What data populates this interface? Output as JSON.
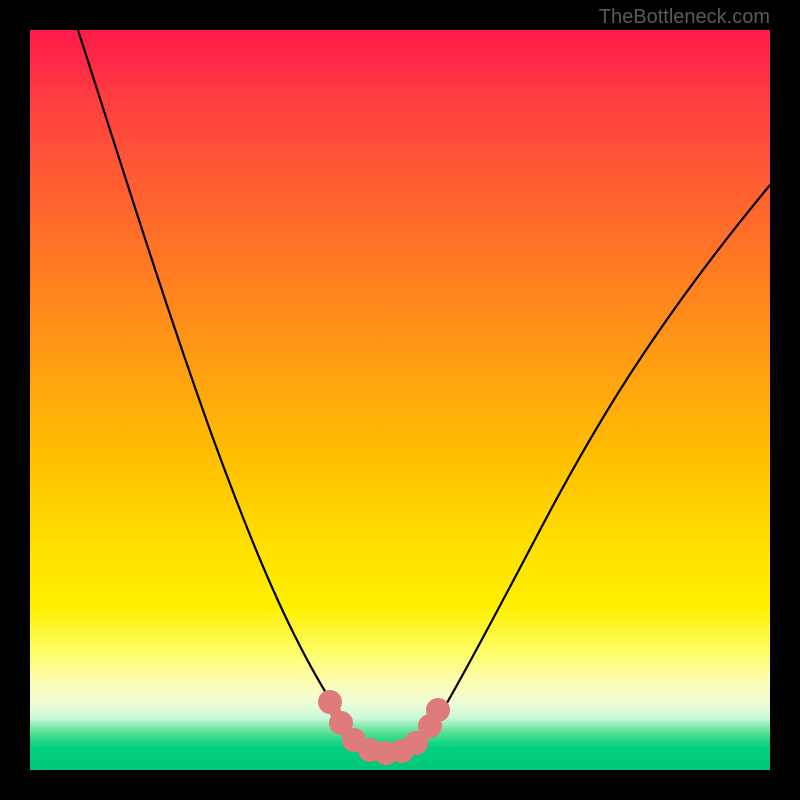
{
  "attribution": "TheBottleneck.com",
  "chart_data": {
    "type": "line",
    "title": "",
    "xlabel": "",
    "ylabel": "",
    "xlim": [
      0,
      100
    ],
    "ylim": [
      0,
      100
    ],
    "background_gradient_meaning": "top=high bottleneck (red), bottom=low bottleneck (green)",
    "series": [
      {
        "name": "bottleneck-curve",
        "color": "#000000",
        "x": [
          5,
          10,
          15,
          20,
          25,
          30,
          35,
          40,
          43,
          46,
          49,
          52,
          55,
          60,
          65,
          70,
          75,
          80,
          85,
          90,
          95,
          100
        ],
        "y": [
          100,
          87,
          75,
          63,
          51,
          39,
          27,
          15,
          6,
          2,
          1,
          1,
          2,
          9,
          18,
          27,
          35,
          43,
          50,
          57,
          63,
          68
        ]
      },
      {
        "name": "optimal-zone-highlight",
        "color": "#e07878",
        "type": "thick-segment",
        "x": [
          41,
          43,
          45,
          47,
          49,
          51,
          53,
          54
        ],
        "y": [
          9,
          5,
          2.5,
          1.5,
          1,
          1,
          2,
          5
        ]
      }
    ]
  }
}
